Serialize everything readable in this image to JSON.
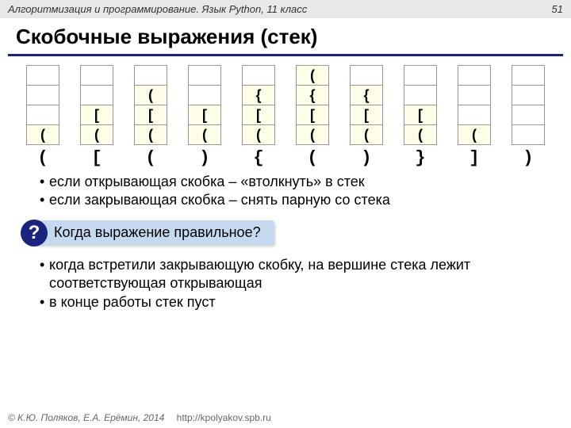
{
  "header": {
    "left": "Алгоритмизация и программирование. Язык Python, 11 класс",
    "page": "51"
  },
  "title": "Скобочные выражения (стек)",
  "stacks": [
    {
      "cells": [
        "",
        "",
        "",
        "("
      ],
      "below": "("
    },
    {
      "cells": [
        "",
        "",
        "[",
        "("
      ],
      "below": "["
    },
    {
      "cells": [
        "",
        "(",
        "[",
        "("
      ],
      "below": "("
    },
    {
      "cells": [
        "",
        "",
        "[",
        "("
      ],
      "below": ")"
    },
    {
      "cells": [
        "",
        "{",
        "[",
        "("
      ],
      "below": "{"
    },
    {
      "cells": [
        "(",
        "{",
        "[",
        "("
      ],
      "below": "("
    },
    {
      "cells": [
        "",
        "{",
        "[",
        "("
      ],
      "below": ")"
    },
    {
      "cells": [
        "",
        "",
        "[",
        "("
      ],
      "below": "}"
    },
    {
      "cells": [
        "",
        "",
        "",
        "("
      ],
      "below": "]"
    },
    {
      "cells": [
        "",
        "",
        "",
        ""
      ],
      "below": ")"
    }
  ],
  "rules": [
    "если открывающая скобка – «втолкнуть» в стек",
    "если закрывающая скобка – снять парную со стека"
  ],
  "question": {
    "mark": "?",
    "label": "Когда выражение правильное?"
  },
  "answers": [
    "когда встретили закрывающую скобку, на вершине стека лежит соответствующая открывающая",
    "в конце работы стек пуст"
  ],
  "footer": {
    "copyright": "© К.Ю. Поляков, Е.А. Ерёмин, 2014",
    "url": "http://kpolyakov.spb.ru"
  }
}
